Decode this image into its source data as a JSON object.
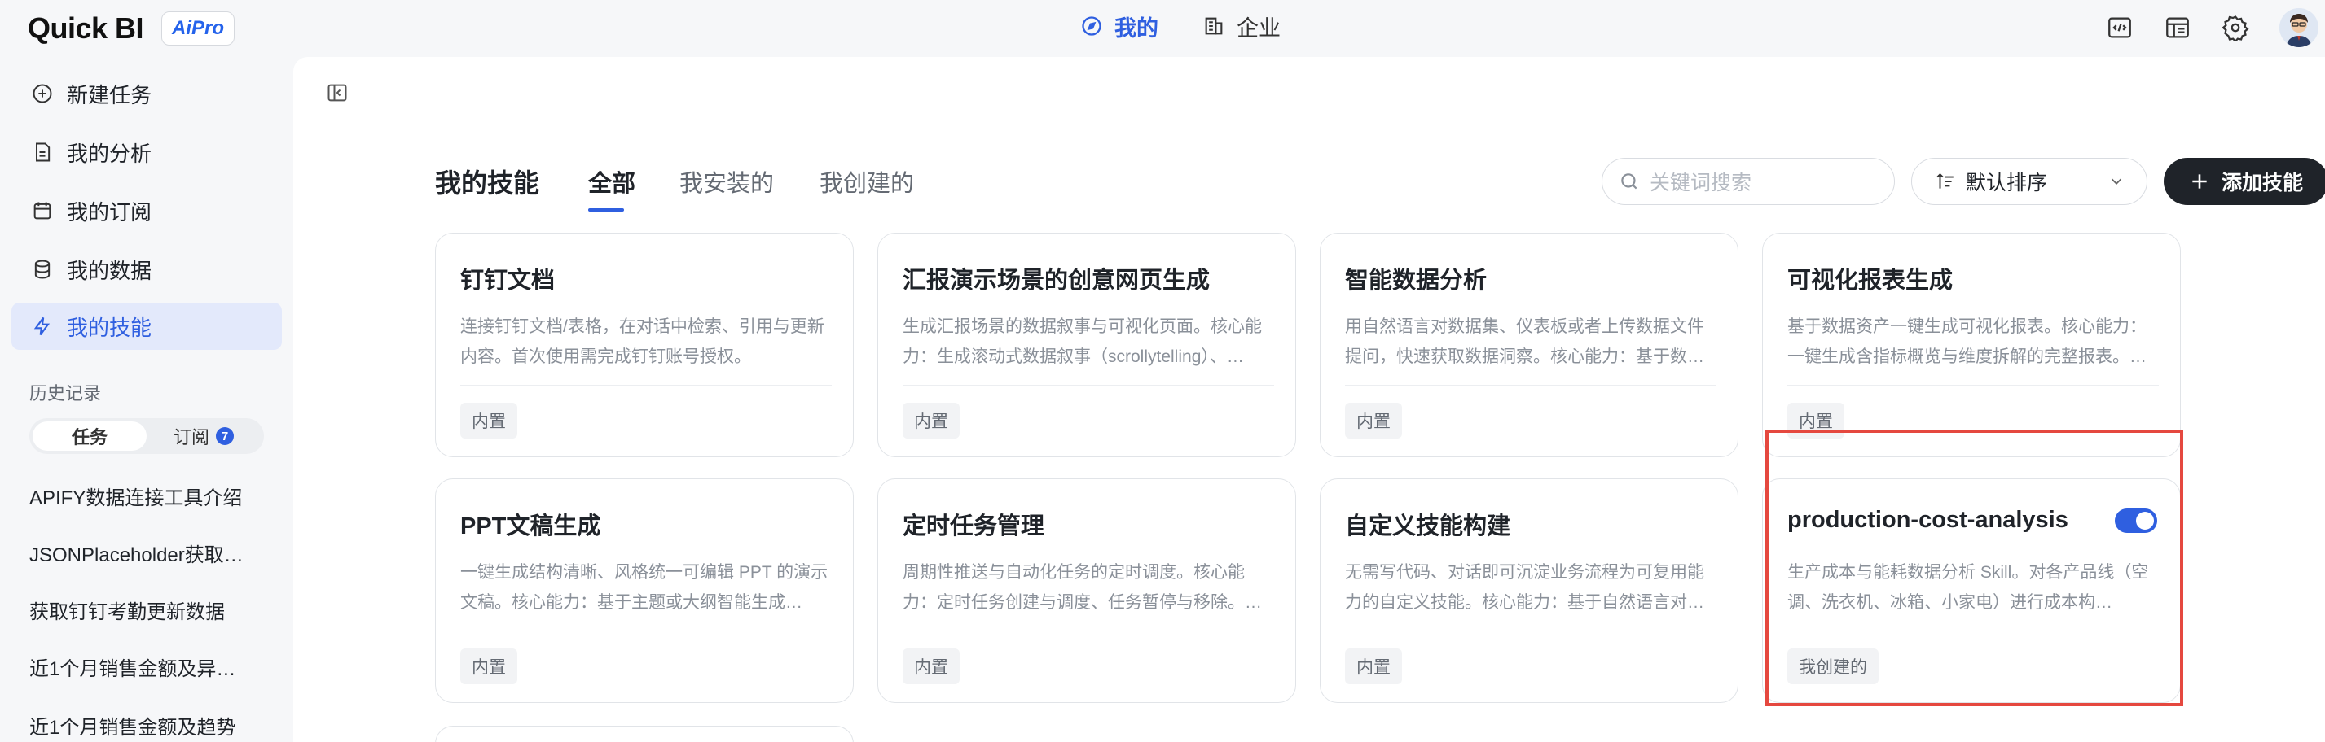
{
  "brand": {
    "logo_text": "Quick BI",
    "badge_text": "AiPro"
  },
  "topnav": {
    "items": [
      {
        "label": "我的",
        "icon": "compass-icon",
        "active": true
      },
      {
        "label": "企业",
        "icon": "building-icon",
        "active": false
      }
    ]
  },
  "topbar_icons": [
    "code-window-icon",
    "dashboard-icon",
    "gear-icon",
    "user-avatar"
  ],
  "sidebar": {
    "items": [
      {
        "label": "新建任务",
        "icon": "plus-circle-icon"
      },
      {
        "label": "我的分析",
        "icon": "document-icon"
      },
      {
        "label": "我的订阅",
        "icon": "calendar-icon"
      },
      {
        "label": "我的数据",
        "icon": "database-icon"
      },
      {
        "label": "我的技能",
        "icon": "lightning-icon",
        "active": true
      }
    ],
    "history_title": "历史记录",
    "history_tabs": [
      {
        "label": "任务",
        "active": true
      },
      {
        "label": "订阅",
        "badge": "7"
      }
    ],
    "history_items": [
      "APIFY数据连接工具介绍",
      "JSONPlaceholder获取…",
      "获取钉钉考勤更新数据",
      "近1个月销售金额及异…",
      "近1个月销售金额及趋势"
    ]
  },
  "main": {
    "title": "我的技能",
    "tabs": [
      {
        "label": "全部",
        "active": true
      },
      {
        "label": "我安装的"
      },
      {
        "label": "我创建的"
      }
    ],
    "search_placeholder": "关键词搜索",
    "sort_label": "默认排序",
    "add_label": "添加技能",
    "cards": [
      {
        "title": "钉钉文档",
        "desc": "连接钉钉文档/表格，在对话中检索、引用与更新内容。首次使用需完成钉钉账号授权。",
        "tag": "内置"
      },
      {
        "title": "汇报演示场景的创意网页生成",
        "desc": "生成汇报场景的数据叙事与可视化页面。核心能力：生成滚动式数据叙事（scrollytelling）、…",
        "tag": "内置"
      },
      {
        "title": "智能数据分析",
        "desc": "用自然语言对数据集、仪表板或者上传数据文件提问，快速获取数据洞察。核心能力：基于数…",
        "tag": "内置"
      },
      {
        "title": "可视化报表生成",
        "desc": "基于数据资产一键生成可视化报表。核心能力：一键生成含指标概览与维度拆解的完整报表。…",
        "tag": "内置"
      },
      {
        "title": "PPT文稿生成",
        "desc": "一键生成结构清晰、风格统一可编辑 PPT 的演示文稿。核心能力：基于主题或大纲智能生成…",
        "tag": "内置"
      },
      {
        "title": "定时任务管理",
        "desc": "周期性推送与自动化任务的定时调度。核心能力：定时任务创建与调度、任务暂停与移除。…",
        "tag": "内置"
      },
      {
        "title": "自定义技能构建",
        "desc": "无需写代码、对话即可沉淀业务流程为可复用能力的自定义技能。核心能力：基于自然语言对…",
        "tag": "内置"
      },
      {
        "title": "production-cost-analysis",
        "desc": "生产成本与能耗数据分析 Skill。对各产品线（空调、洗衣机、冰箱、小家电）进行成本构…",
        "tag": "我创建的",
        "toggle_on": true
      }
    ]
  },
  "colors": {
    "accent": "#2f5fe0",
    "highlight": "#e5483f",
    "dark_button": "#1f2329"
  }
}
